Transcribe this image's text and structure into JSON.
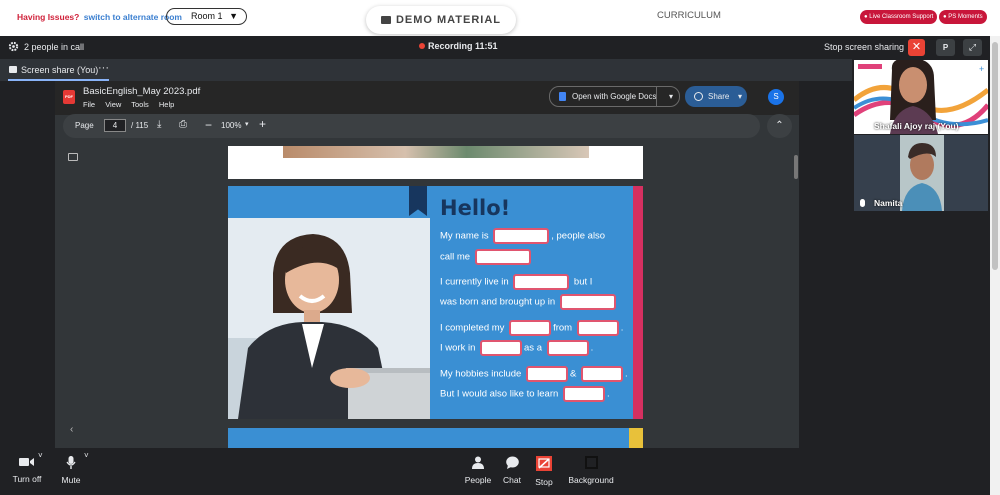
{
  "top": {
    "issues_text": "Having Issues?",
    "alternate_link": "switch to alternate room",
    "room_select": "Room 1",
    "demo_button": "DEMO MATERIAL",
    "curriculum": "CURRICULUM",
    "live_support": "Live Classroom Support",
    "moments": "PS Moments"
  },
  "call": {
    "people_count": "2 people in call",
    "recording": "Recording 11:51",
    "stop_sharing": "Stop screen sharing",
    "pin_label": "P",
    "share_tab": "Screen share (You)"
  },
  "pdf": {
    "icon_text": "PDF",
    "filename": "BasicEnglish_May 2023.pdf",
    "menu": [
      "File",
      "View",
      "Tools",
      "Help"
    ],
    "open_with": "Open with Google Docs",
    "share": "Share",
    "account_initial": "S",
    "page_label": "Page",
    "page_current": "4",
    "page_total": "/   115",
    "zoom": "100%",
    "slide": {
      "heading": "Hello!",
      "lines": [
        [
          "My name is",
          ", people also"
        ],
        [
          "call me",
          ""
        ],
        [
          "I currently live in",
          " but I"
        ],
        [
          "was born and brought up in",
          ""
        ],
        [
          "I completed my",
          "from",
          "."
        ],
        [
          "I work in",
          "as a",
          "."
        ],
        [
          "My hobbies include",
          "&",
          "."
        ],
        [
          "But I would also like to learn",
          "."
        ]
      ]
    }
  },
  "participants": [
    {
      "name": "Shafali Ajoy raj (You)"
    },
    {
      "name": "Namita"
    }
  ],
  "controls": {
    "camera": "Turn off",
    "mic": "Mute",
    "people": "People",
    "chat": "Chat",
    "stop": "Stop",
    "background": "Background"
  },
  "colors": {
    "slide_blue": "#3a8fd3",
    "heading_navy": "#17365e",
    "accent_pink": "#d53060",
    "recording_red": "#ea4335"
  }
}
